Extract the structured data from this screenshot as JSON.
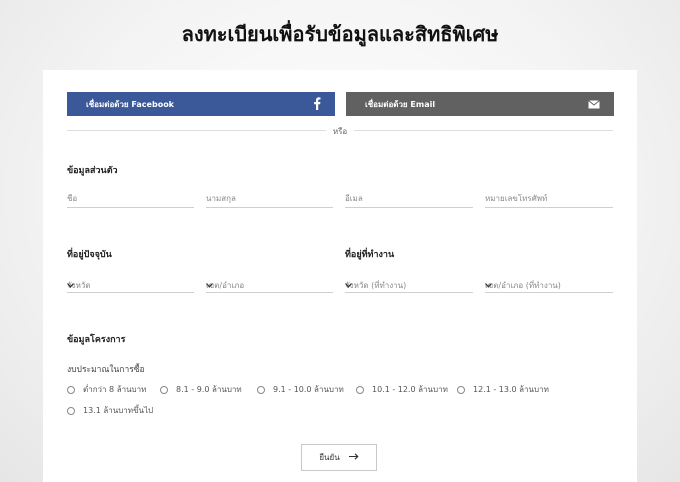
{
  "page_title": "ลงทะเบียนเพื่อรับข้อมูลและสิทธิพิเศษ",
  "social": {
    "facebook_label": "เชื่อมต่อด้วย Facebook",
    "email_label": "เชื่อมต่อด้วย Email",
    "or_text": "หรือ",
    "facebook_color": "#3b5998",
    "email_color": "#616161"
  },
  "personal": {
    "title": "ข้อมูลส่วนตัว",
    "first_name_placeholder": "ชื่อ",
    "last_name_placeholder": "นามสกุล",
    "email_placeholder": "อีเมล",
    "phone_placeholder": "หมายเลขโทรศัพท์"
  },
  "home_address": {
    "title": "ที่อยู่ปัจจุบัน",
    "province_placeholder": "จังหวัด",
    "district_placeholder": "เขต/อำเภอ"
  },
  "work_address": {
    "title": "ที่อยู่ที่ทำงาน",
    "province_placeholder": "จังหวัด (ที่ทำงาน)",
    "district_placeholder": "เขต/อำเภอ (ที่ทำงาน)"
  },
  "project": {
    "title": "ข้อมูลโครงการ",
    "budget_label": "งบประมาณในการซื้อ",
    "budget_options": [
      "ต่ำกว่า 8 ล้านบาท",
      "8.1 - 9.0 ล้านบาท",
      "9.1 - 10.0 ล้านบาท",
      "10.1 - 12.0 ล้านบาท",
      "12.1 - 13.0 ล้านบาท",
      "13.1 ล้านบาทขึ้นไป"
    ]
  },
  "submit_label": "ยืนยัน"
}
